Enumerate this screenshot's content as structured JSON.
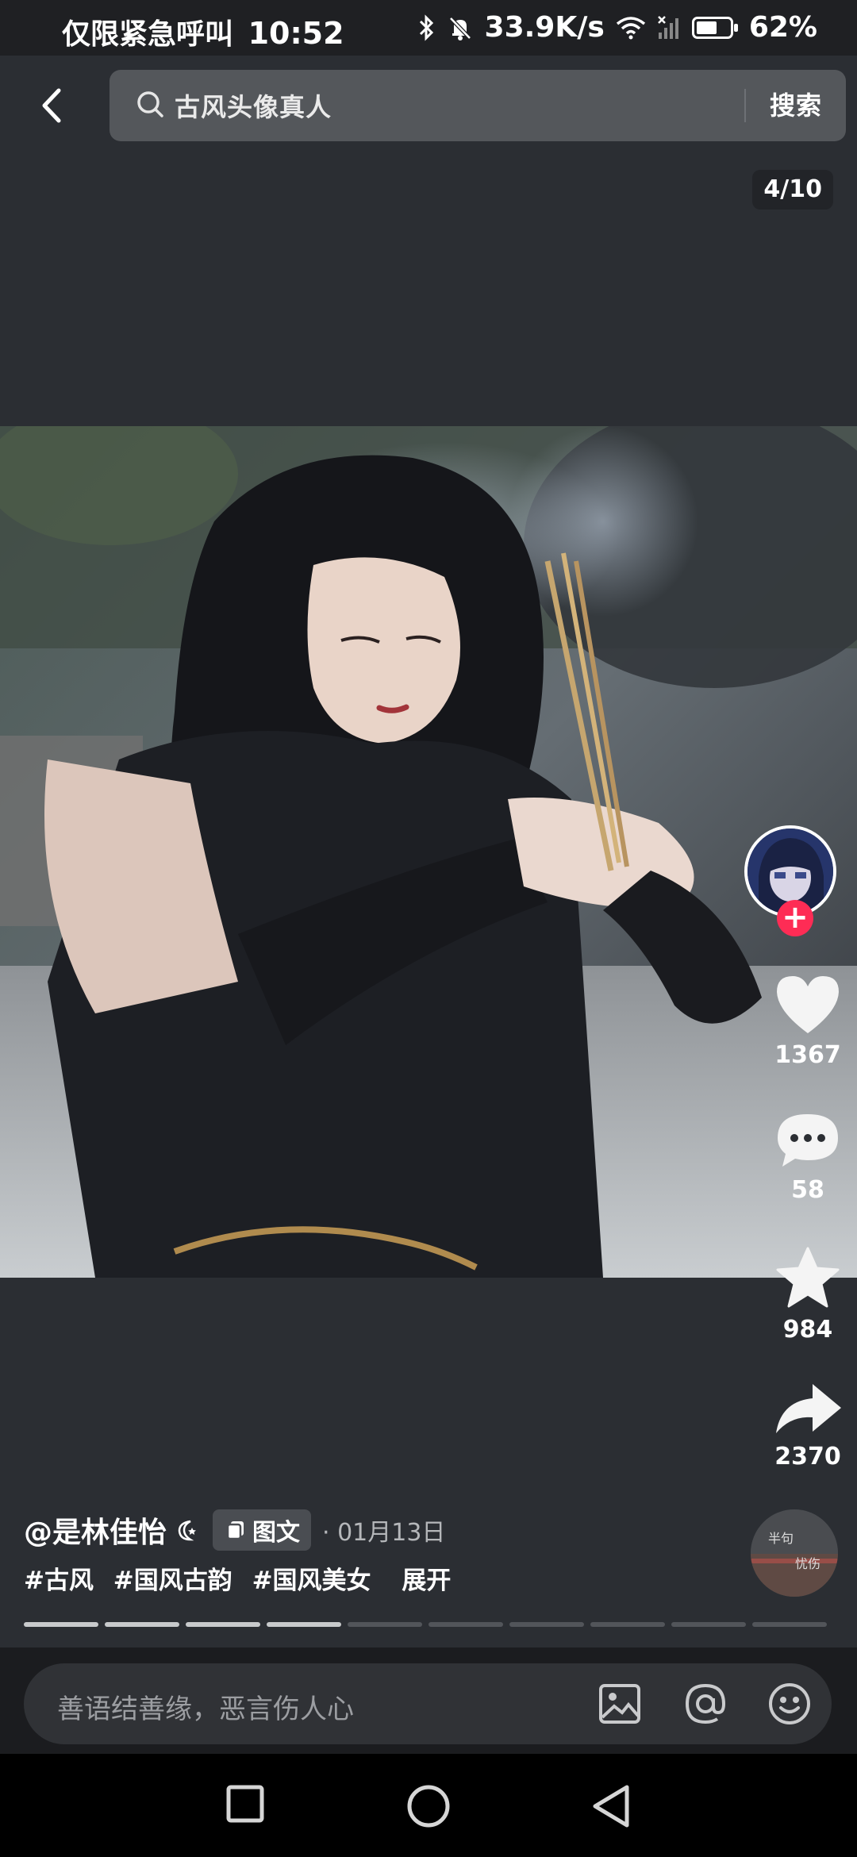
{
  "status_bar": {
    "carrier": "仅限紧急呼叫",
    "time": "10:52",
    "speed": "33.9K/s",
    "battery": "62%",
    "battery_level": 0.62,
    "icons": [
      "bluetooth-icon",
      "mute-icon",
      "wifi-icon",
      "signal-icon",
      "battery-icon"
    ]
  },
  "header": {
    "back_icon": "chevron-left-icon",
    "search_query": "古风头像真人",
    "search_button": "搜索"
  },
  "gallery": {
    "counter": "4/10",
    "current": 4,
    "total": 10
  },
  "actions": {
    "likes": "1367",
    "comments": "58",
    "favorites": "984",
    "shares": "2370",
    "follow_symbol": "+"
  },
  "post": {
    "author": "@是林佳怡",
    "type_badge": "图文",
    "date": "· 01月13日",
    "hashtags": [
      "#古风",
      "#国风古韵",
      "#国风美女"
    ],
    "expand": "展开",
    "music_disc_text_1": "半句",
    "music_disc_text_2": "忧伤"
  },
  "comment_bar": {
    "placeholder": "善语结善缘，恶言伤人心",
    "icons": [
      "image-icon",
      "mention-icon",
      "emoji-icon"
    ]
  },
  "nav": {
    "icons": [
      "recents-square-icon",
      "home-circle-icon",
      "back-triangle-icon"
    ]
  },
  "colors": {
    "background": "#2b2e33",
    "accent": "#fe2c55",
    "search_bg": "#54575b"
  }
}
